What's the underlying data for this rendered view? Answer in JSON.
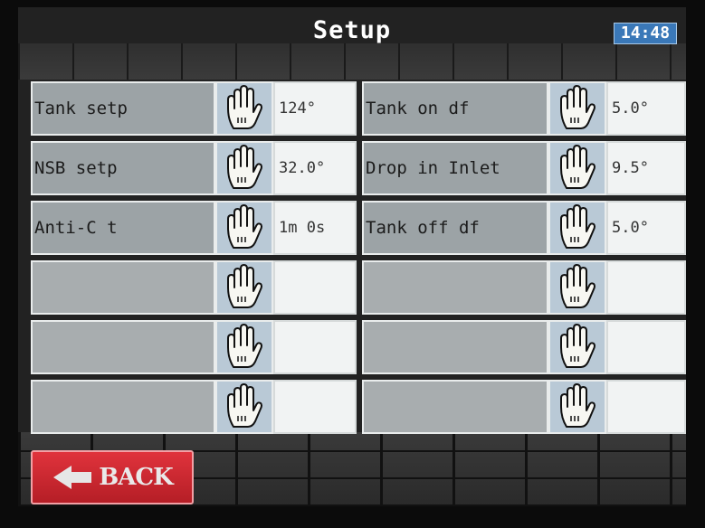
{
  "header": {
    "title": "Setup",
    "clock": "14:48"
  },
  "left_rows": [
    {
      "label": "Tank setp",
      "value": "124°"
    },
    {
      "label": "NSB setp",
      "value": "32.0°"
    },
    {
      "label": "Anti-C t",
      "value": "1m 0s"
    },
    {
      "label": "",
      "value": ""
    },
    {
      "label": "",
      "value": ""
    },
    {
      "label": "",
      "value": ""
    }
  ],
  "right_rows": [
    {
      "label": "Tank on df",
      "value": "5.0°"
    },
    {
      "label": "Drop in Inlet",
      "value": "9.5°"
    },
    {
      "label": "Tank off df",
      "value": "5.0°"
    },
    {
      "label": "",
      "value": ""
    },
    {
      "label": "",
      "value": ""
    },
    {
      "label": "",
      "value": ""
    }
  ],
  "icons": {
    "edit": "hand-icon",
    "back_arrow": "left-arrow-icon"
  },
  "back_button": {
    "label": "BACK"
  },
  "colors": {
    "label_bg": "#9ca3a6",
    "hand_bg": "#b9c9d6",
    "value_bg": "#f1f3f3",
    "back_red": "#d2262e",
    "clock_bg": "#3a78b8"
  }
}
